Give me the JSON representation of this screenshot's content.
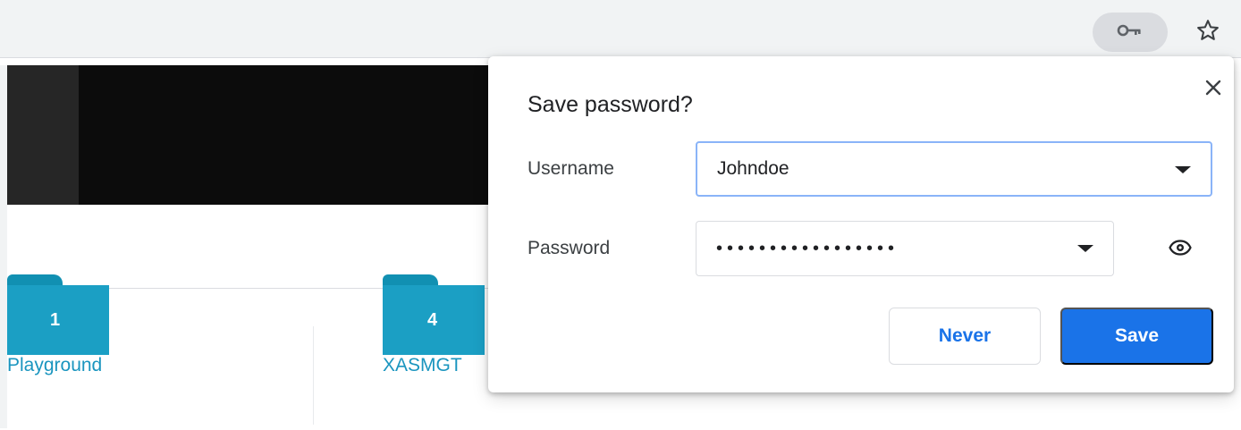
{
  "toolbar": {
    "key_icon": "key-icon",
    "star_icon": "star-icon"
  },
  "page": {
    "folders": [
      {
        "count": "1",
        "name": "Playground"
      },
      {
        "count": "4",
        "name": "XASMGT"
      }
    ],
    "colors": {
      "folder": "#1b9fc4",
      "folder_text": "#1a95bf"
    }
  },
  "dialog": {
    "title": "Save password?",
    "close_icon": "close-icon",
    "username_label": "Username",
    "username_value": "Johndoe",
    "password_label": "Password",
    "password_value": "•••••••••••••••••",
    "eye_icon": "eye-icon",
    "never_label": "Never",
    "save_label": "Save",
    "colors": {
      "accent": "#1a73e8",
      "focus_border": "#8ab4f8"
    }
  }
}
